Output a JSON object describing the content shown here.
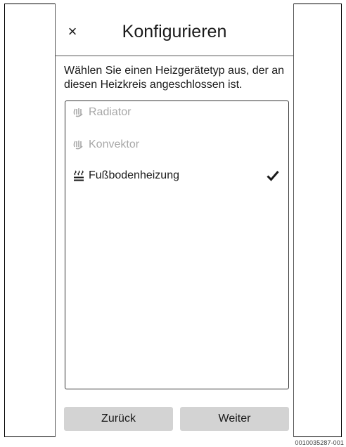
{
  "header": {
    "close_glyph": "×",
    "title": "Konfigurieren"
  },
  "instruction": "Wählen Sie einen Heizgerätetyp aus, der an diesen Heizkreis angeschlossen ist.",
  "options": [
    {
      "label": "Radiator",
      "icon": "radiator-icon",
      "enabled": false,
      "selected": false
    },
    {
      "label": "Konvektor",
      "icon": "convector-icon",
      "enabled": false,
      "selected": false
    },
    {
      "label": "Fußbodenheizung",
      "icon": "floor-heating-icon",
      "enabled": true,
      "selected": true
    }
  ],
  "buttons": {
    "back_label": "Zurück",
    "next_label": "Weiter"
  },
  "figure_id": "0010035287-001",
  "colors": {
    "disabled_text": "#a8a8a8",
    "button_bg": "#d3d3d3",
    "text": "#1a1a1a"
  }
}
